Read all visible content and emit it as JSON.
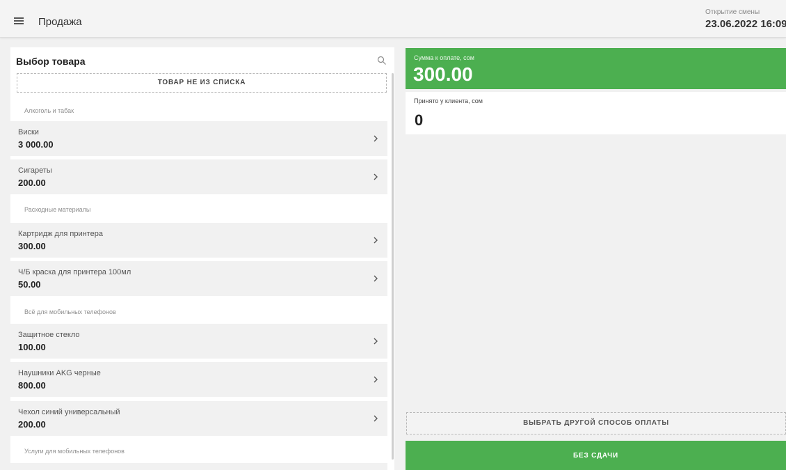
{
  "header": {
    "title": "Продажа",
    "shift_label": "Открытие смены",
    "shift_value": "23.06.2022 16:09"
  },
  "catalog": {
    "title": "Выбор товара",
    "custom_item_label": "ТОВАР НЕ ИЗ СПИСКА",
    "categories": [
      {
        "name": "Алкоголь и табак",
        "items": [
          {
            "name": "Виски",
            "price": "3 000.00"
          },
          {
            "name": "Сигареты",
            "price": "200.00"
          }
        ]
      },
      {
        "name": "Расходные материалы",
        "items": [
          {
            "name": "Картридж для принтера",
            "price": "300.00"
          },
          {
            "name": "Ч/Б краска для принтера 100мл",
            "price": "50.00"
          }
        ]
      },
      {
        "name": "Всё для мобильных телефонов",
        "items": [
          {
            "name": "Защитное стекло",
            "price": "100.00"
          },
          {
            "name": "Наушники AKG черные",
            "price": "800.00"
          },
          {
            "name": "Чехол синий универсальный",
            "price": "200.00"
          }
        ]
      },
      {
        "name": "Услуги для мобильных телефонов",
        "items": []
      }
    ]
  },
  "payment": {
    "due_label": "Сумма к оплате, сом",
    "due_amount": "300.00",
    "received_label": "Принято у клиента, сом",
    "received_amount": "0",
    "other_method_label": "ВЫБРАТЬ ДРУГОЙ СПОСОБ ОПЛАТЫ",
    "no_change_label": "БЕЗ СДАЧИ"
  },
  "colors": {
    "accent": "#4caf50",
    "background": "#f1f1f1"
  }
}
